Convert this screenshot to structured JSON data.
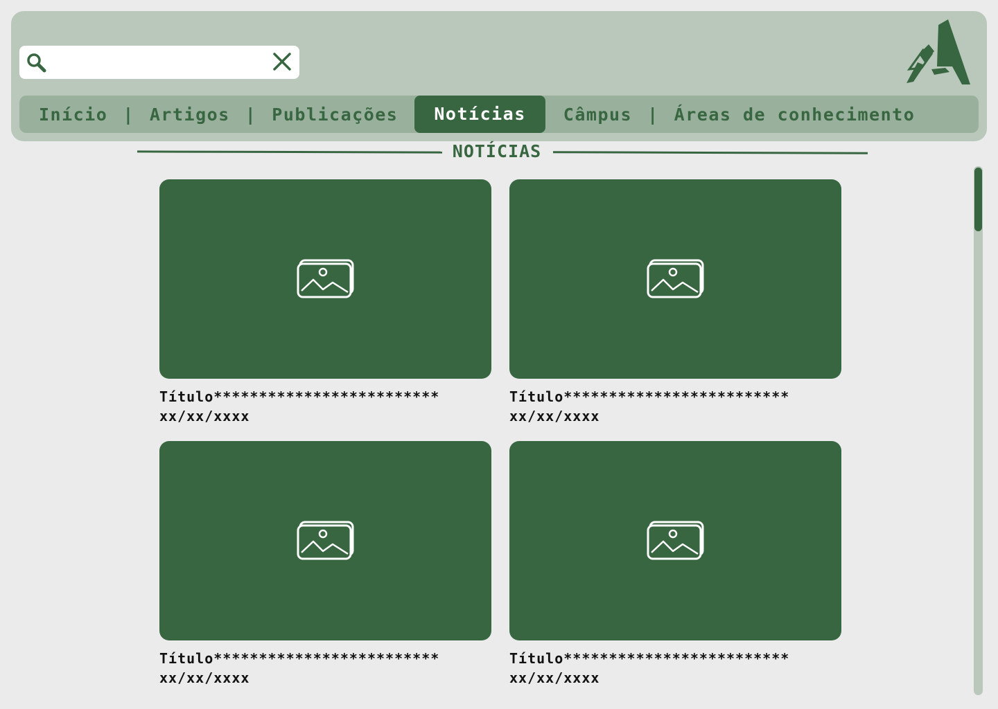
{
  "header": {
    "search": {
      "value": "",
      "placeholder": ""
    }
  },
  "nav": {
    "items": [
      {
        "label": "Início"
      },
      {
        "label": "Artigos"
      },
      {
        "label": "Publicações"
      },
      {
        "label": "Notícias",
        "active": true
      },
      {
        "label": "Câmpus"
      },
      {
        "label": "Áreas de conhecimento"
      }
    ],
    "separator": "|"
  },
  "section": {
    "title": "NOTÍCIAS"
  },
  "news": [
    {
      "title": "Título*************************",
      "date": "xx/xx/xxxx",
      "image_icon": "image-icon"
    },
    {
      "title": "Título*************************",
      "date": "xx/xx/xxxx",
      "image_icon": "image-icon"
    },
    {
      "title": "Título*************************",
      "date": "xx/xx/xxxx",
      "image_icon": "image-icon"
    },
    {
      "title": "Título*************************",
      "date": "xx/xx/xxxx",
      "image_icon": "image-icon"
    }
  ],
  "colors": {
    "primary": "#386641",
    "header_bg": "#bac8bc",
    "nav_bg": "#98b09c",
    "page_bg": "#ebebeb"
  }
}
